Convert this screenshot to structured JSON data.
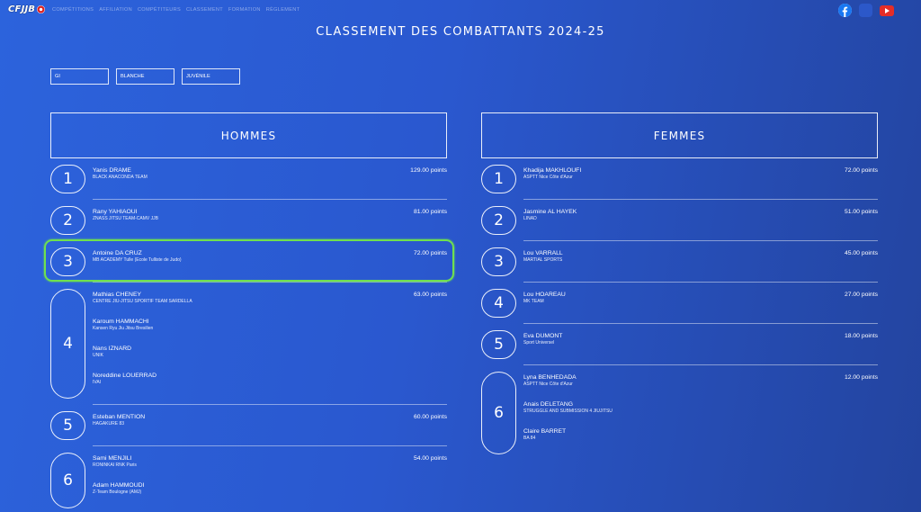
{
  "header": {
    "logo_text": "CFJJB",
    "nav": [
      "COMPÉTITIONS",
      "AFFILIATION",
      "COMPÉTITEURS",
      "CLASSEMENT",
      "FORMATION",
      "RÈGLEMENT"
    ],
    "social": [
      "facebook-icon",
      "instagram-icon",
      "youtube-icon",
      "tiktok-icon"
    ]
  },
  "page_title": "CLASSEMENT DES COMBATTANTS 2024-25",
  "filters": [
    "GI",
    "BLANCHE",
    "JUVÉNILE"
  ],
  "men": {
    "title": "HOMMES",
    "ranks": [
      {
        "rank": "1",
        "points": "129.00 points",
        "athletes": [
          {
            "name": "Yanis DRAME",
            "club": "BLACK ANACONDA TEAM"
          }
        ]
      },
      {
        "rank": "2",
        "points": "81.00 points",
        "athletes": [
          {
            "name": "Rany YAHIAOUI",
            "club": "ZNASS JITSU TEAM-CAMV JJB"
          }
        ]
      },
      {
        "rank": "3",
        "points": "72.00 points",
        "athletes": [
          {
            "name": "Antoine DA CRUZ",
            "club": "MB ACADEMY Tulle (Ecole Tulliste de Judo)"
          }
        ]
      },
      {
        "rank": "4",
        "points": "63.00 points",
        "athletes": [
          {
            "name": "Mathias CHENEY",
            "club": "CENTRE JIU-JITSU SPORTIF TEAM SARDELLA"
          },
          {
            "name": "Karoum HAMMACHI",
            "club": "Kansen Ryu Jiu Jitsu Bresilien"
          },
          {
            "name": "Nans IZNARD",
            "club": "UNIK"
          },
          {
            "name": "Noreddine LOUERRAD",
            "club": "IVAI"
          }
        ]
      },
      {
        "rank": "5",
        "points": "60.00 points",
        "athletes": [
          {
            "name": "Esteban MENTION",
            "club": "HAGAKURE 83"
          }
        ]
      },
      {
        "rank": "6",
        "points": "54.00 points",
        "athletes": [
          {
            "name": "Sami MENJILI",
            "club": "RONINKAI RNK Paris"
          },
          {
            "name": "Adam HAMMOUDI",
            "club": "Z-Team Boulogne (AMJ)"
          }
        ]
      }
    ]
  },
  "women": {
    "title": "FEMMES",
    "ranks": [
      {
        "rank": "1",
        "points": "72.00 points",
        "athletes": [
          {
            "name": "Khadija MAKHLOUFI",
            "club": "ASPTT Nice Côte d'Azur"
          }
        ]
      },
      {
        "rank": "2",
        "points": "51.00 points",
        "athletes": [
          {
            "name": "Jasmine AL HAYEK",
            "club": "LINAD"
          }
        ]
      },
      {
        "rank": "3",
        "points": "45.00 points",
        "athletes": [
          {
            "name": "Lou VARRALL",
            "club": "MARTIAL SPORTS"
          }
        ]
      },
      {
        "rank": "4",
        "points": "27.00 points",
        "athletes": [
          {
            "name": "Lou HOAREAU",
            "club": "MK TEAM"
          }
        ]
      },
      {
        "rank": "5",
        "points": "18.00 points",
        "athletes": [
          {
            "name": "Eva DUMONT",
            "club": "Sport Universel"
          }
        ]
      },
      {
        "rank": "6",
        "points": "12.00 points",
        "athletes": [
          {
            "name": "Lyna BENHEDADA",
            "club": "ASPTT Nice Côte d'Azur"
          },
          {
            "name": "Anais DELETANG",
            "club": "STRUGGLE AND SUBMISSION 4 JIUJITSU"
          },
          {
            "name": "Claire BARRET",
            "club": "BA 84"
          }
        ]
      }
    ]
  },
  "colors": {
    "highlight": "#6fe04f",
    "bg_start": "#2c63dc",
    "bg_end": "#23449f"
  }
}
